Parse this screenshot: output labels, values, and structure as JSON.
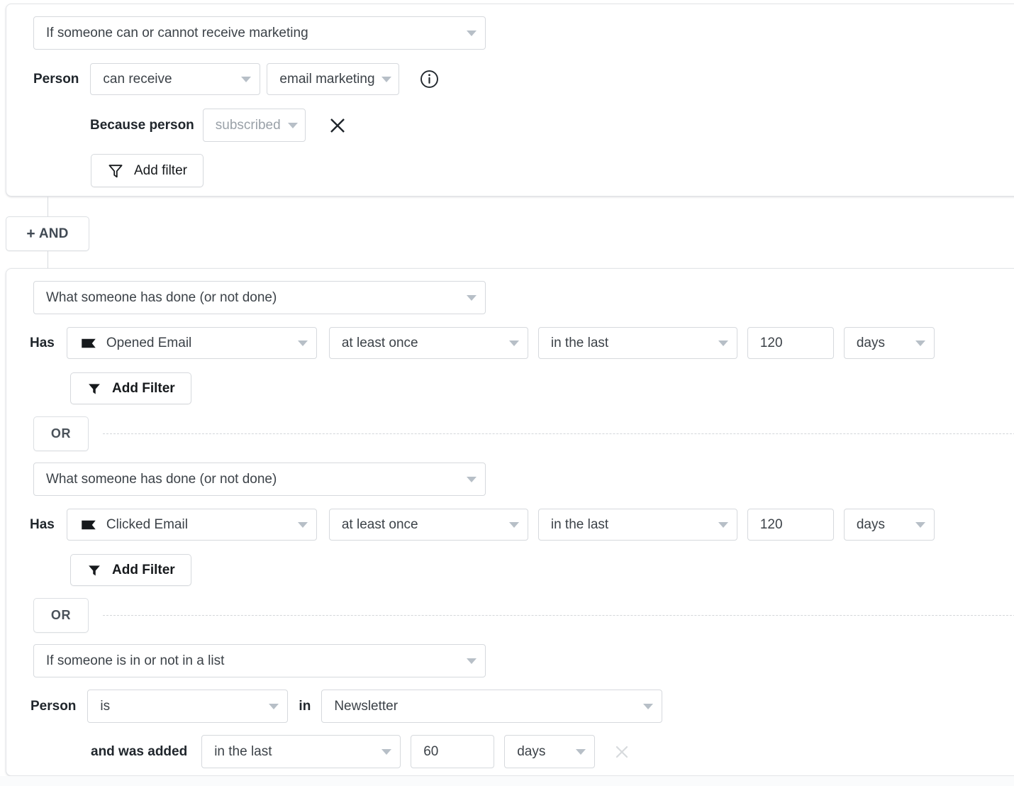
{
  "groups": [
    {
      "id": "group-marketing",
      "condition_type": "If someone can or cannot receive marketing",
      "subject_label": "Person",
      "operator": "can receive",
      "channel": "email marketing",
      "info_icon": "info-circle-icon",
      "reason_label": "Because person",
      "reason_value": "subscribed",
      "remove_icon": "close-icon",
      "add_filter_label": "Add filter",
      "add_filter_icon": "funnel-outline-icon"
    }
  ],
  "connector": {
    "and_label": "AND",
    "and_plus": "+",
    "or_label": "OR"
  },
  "blocks": [
    {
      "id": "block-opened-email",
      "condition_type": "What someone has done (or not done)",
      "verb_label": "Has",
      "metric": "Opened Email",
      "metric_icon": "flag-icon",
      "frequency": "at least once",
      "timeframe": "in the last",
      "amount": "120",
      "unit": "days",
      "add_filter_label": "Add Filter",
      "add_filter_icon": "funnel-solid-icon"
    },
    {
      "id": "block-clicked-email",
      "condition_type": "What someone has done (or not done)",
      "verb_label": "Has",
      "metric": "Clicked Email",
      "metric_icon": "flag-icon",
      "frequency": "at least once",
      "timeframe": "in the last",
      "amount": "120",
      "unit": "days",
      "add_filter_label": "Add Filter",
      "add_filter_icon": "funnel-solid-icon"
    }
  ],
  "list_block": {
    "id": "block-list-membership",
    "condition_type": "If someone is in or not in a list",
    "subject_label": "Person",
    "operator": "is",
    "preposition": "in",
    "list_name": "Newsletter",
    "added_label": "and was added",
    "added_timeframe": "in the last",
    "added_amount": "60",
    "added_unit": "days",
    "remove_icon": "close-icon"
  },
  "colors": {
    "border": "#d6d9dd",
    "text": "#3c4248",
    "muted": "#9aa1a8",
    "caret": "#b7bfc7",
    "dashed": "#d3d6da"
  }
}
